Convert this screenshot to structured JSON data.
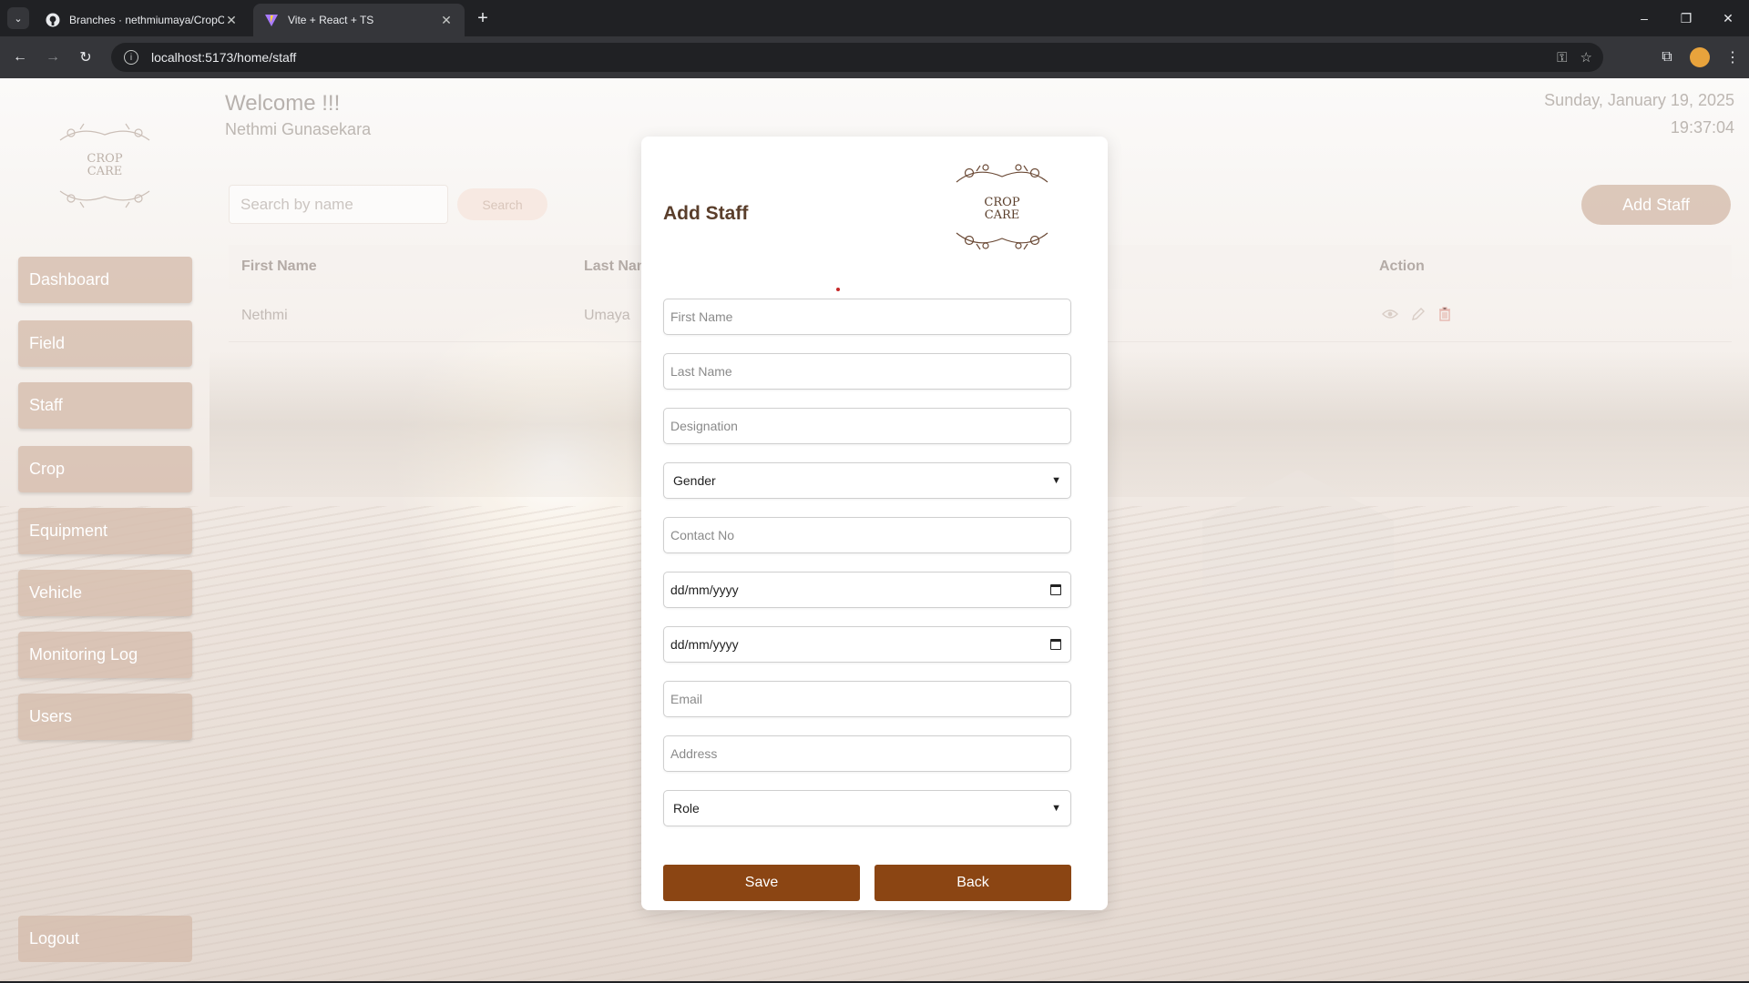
{
  "browser": {
    "tabs": [
      {
        "title": "Branches · nethmiumaya/CropC",
        "active": false,
        "icon": "github-icon"
      },
      {
        "title": "Vite + React + TS",
        "active": true,
        "icon": "vite-icon"
      }
    ],
    "url": "localhost:5173/home/staff"
  },
  "header": {
    "welcome": "Welcome !!!",
    "user_name": "Nethmi Gunasekara",
    "date": "Sunday, January 19, 2025",
    "time": "19:37:04"
  },
  "logo": {
    "line1": "CROP",
    "line2": "CARE"
  },
  "sidebar": {
    "items": [
      {
        "label": "Dashboard"
      },
      {
        "label": "Field"
      },
      {
        "label": "Staff"
      },
      {
        "label": "Crop"
      },
      {
        "label": "Equipment"
      },
      {
        "label": "Vehicle"
      },
      {
        "label": "Monitoring Log"
      },
      {
        "label": "Users"
      }
    ],
    "logout": "Logout"
  },
  "main": {
    "search_placeholder": "Search by name",
    "search_button": "Search",
    "add_button": "Add Staff",
    "table": {
      "columns": [
        "First Name",
        "Last Name",
        "Action"
      ],
      "rows": [
        {
          "first_name": "Nethmi",
          "last_name": "Umaya"
        }
      ]
    }
  },
  "modal": {
    "title": "Add Staff",
    "fields": {
      "first_name": "First Name",
      "last_name": "Last Name",
      "designation": "Designation",
      "gender": "Gender",
      "contact_no": "Contact No",
      "date1": "dd/mm/yyyy",
      "date2": "dd/mm/yyyy",
      "email": "Email",
      "address": "Address",
      "role": "Role"
    },
    "save": "Save",
    "back": "Back"
  },
  "colors": {
    "accent": "#8b4513",
    "sidebar_button": "#d6bdad",
    "title": "#5a3e2b"
  }
}
